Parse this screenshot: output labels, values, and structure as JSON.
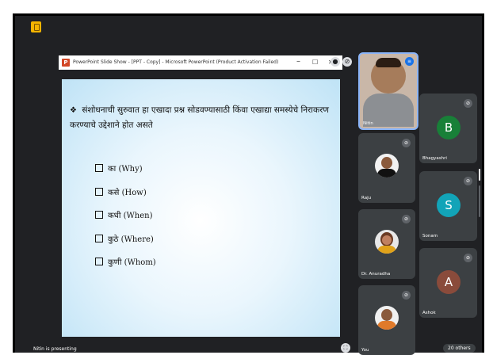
{
  "ppt_window": {
    "title": "PowerPoint Slide Show - [PPT - Copy] - Microsoft PowerPoint (Product Activation Failed)",
    "minimize": "–",
    "maximize": "☐",
    "close": "✕"
  },
  "slide": {
    "bullet_text": "संशोधनाची सुरुवात हा एखादा प्रश्न सोडवण्यासाठी किंवा एखाद्या समस्येचे निराकरण करण्याचे उद्देशाने होत असते",
    "bullet_symbol": "❖",
    "items": [
      {
        "label": "का (Why)"
      },
      {
        "label": "कसे (How)"
      },
      {
        "label": "कधी (When)"
      },
      {
        "label": "कुठे (Where)"
      },
      {
        "label": "कुणी (Whom)"
      }
    ]
  },
  "participants": [
    {
      "name": "Nitin",
      "type": "video"
    },
    {
      "name": "Bhagyashri",
      "type": "letter",
      "letter": "B",
      "color": "#188038"
    },
    {
      "name": "Raju",
      "type": "photo"
    },
    {
      "name": "Sonam",
      "type": "letter",
      "letter": "S",
      "color": "#12a4b8"
    },
    {
      "name": "Dr. Anuradha",
      "type": "photo"
    },
    {
      "name": "Ashok",
      "type": "letter",
      "letter": "A",
      "color": "#8a4b3b"
    },
    {
      "name": "You",
      "type": "photo"
    }
  ],
  "presenting_label": "Nitin is presenting",
  "others_count": "20 others",
  "icons": {
    "doc": "doc-icon",
    "mic_off": "mic-off-icon",
    "pin": "pin-icon",
    "fullscreen": "fullscreen-icon"
  }
}
